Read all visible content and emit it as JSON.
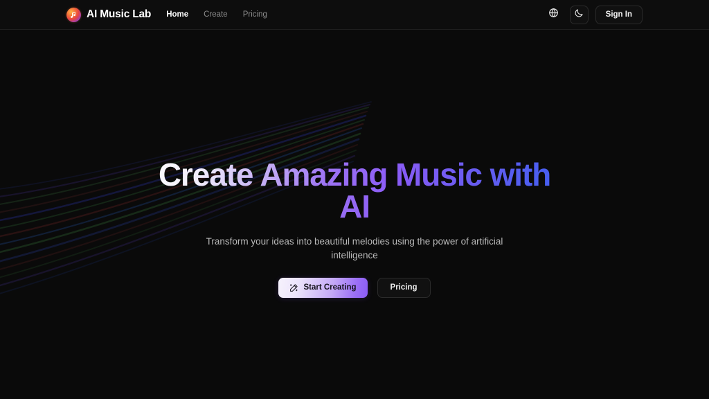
{
  "brand": {
    "name": "AI Music Lab",
    "logo_icon": "music-note-circle-icon"
  },
  "nav": {
    "links": [
      {
        "label": "Home",
        "active": true
      },
      {
        "label": "Create",
        "active": false
      },
      {
        "label": "Pricing",
        "active": false
      }
    ],
    "actions": {
      "language_icon": "globe-icon",
      "theme_icon": "moon-icon",
      "sign_in_label": "Sign In"
    }
  },
  "hero": {
    "headline_line1_plain": "Create ",
    "headline_line1_accent": "Amazing Music",
    "headline_line2": "with AI",
    "headline_full": "Create Amazing Music with AI",
    "subtitle": "Transform your ideas into beautiful melodies using the power of artificial intelligence",
    "primary_cta": {
      "label": "Start Creating",
      "icon": "magic-wand-icon"
    },
    "secondary_cta": {
      "label": "Pricing"
    }
  },
  "colors": {
    "background": "#0a0a0a",
    "navbar_background": "#0d0d0d",
    "navbar_border": "#1e1e1e",
    "accent_purple": "#8b5cf6",
    "accent_blue": "#4a5ef0",
    "text_primary": "#ffffff",
    "text_muted": "#8b8b8b",
    "subtitle_text": "#b9b9b9",
    "wave_green": "#1f4d23",
    "wave_blue": "#1b2a7a",
    "wave_red": "#5a1d1d",
    "wave_purple": "#3a2470"
  }
}
